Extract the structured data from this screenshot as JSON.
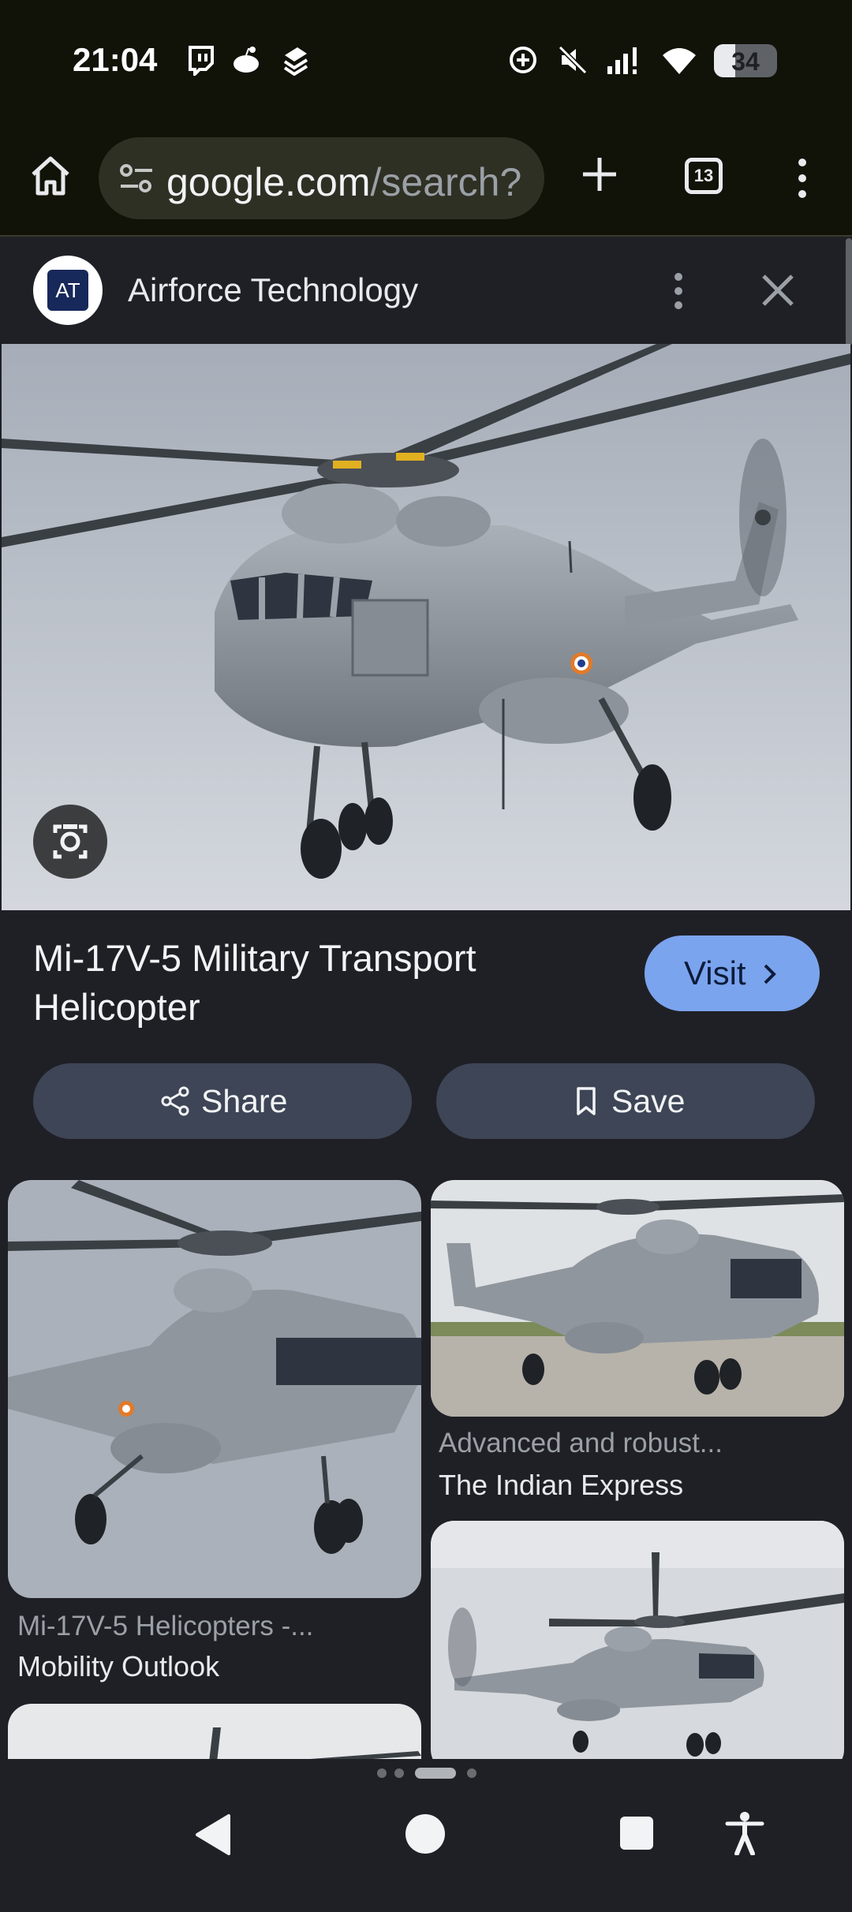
{
  "status_bar": {
    "time": "21:04",
    "left_icons": [
      "twitch-icon",
      "reddit-icon",
      "layers-app-icon"
    ],
    "right_icons": [
      "data-saver-icon",
      "mute-icon",
      "signal-icon",
      "wifi-icon"
    ],
    "battery_level": "34"
  },
  "browser": {
    "url_domain": "google.com",
    "url_path": "/search?",
    "tab_count": "13"
  },
  "viewer": {
    "source_name": "Airforce Technology",
    "source_logo_text": "AT",
    "title": "Mi-17V-5 Military Transport Helicopter",
    "visit_label": "Visit",
    "share_label": "Share",
    "save_label": "Save"
  },
  "related": [
    {
      "caption": "Mi-17V-5 Helicopters -...",
      "source": "Mobility Outlook"
    },
    {
      "caption": "Advanced and robust...",
      "source": "The Indian Express"
    },
    {
      "caption": "",
      "source": ""
    },
    {
      "caption": "",
      "source": ""
    }
  ],
  "colors": {
    "accent_visit": "#7ba4ee",
    "button_bg": "#3d4556",
    "background": "#1f2026"
  }
}
